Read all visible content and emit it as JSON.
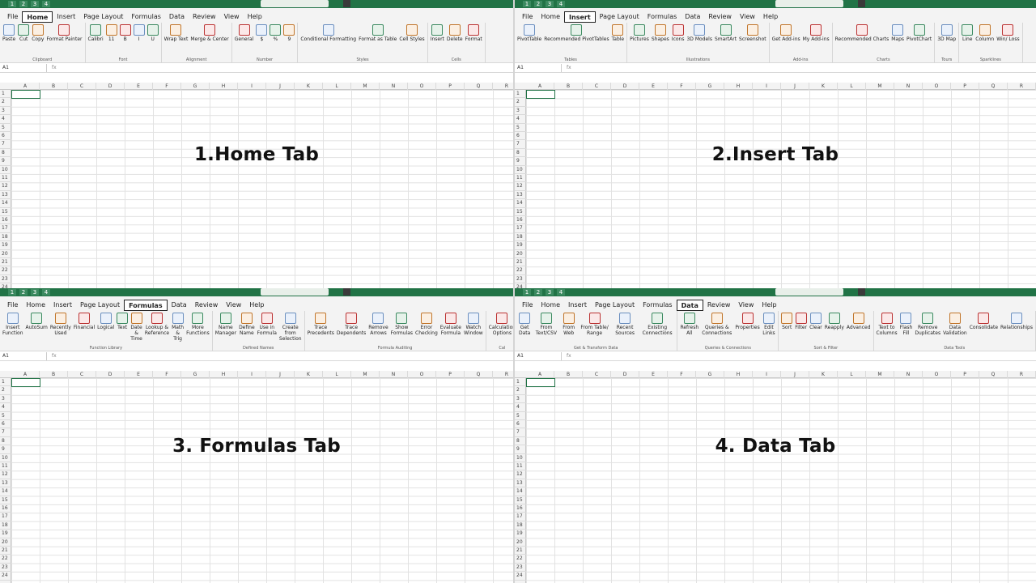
{
  "panels": [
    {
      "caption": "1.Home Tab",
      "selected_tab": "Home",
      "groups": [
        {
          "name": "Clipboard",
          "items": [
            "Paste",
            "Cut",
            "Copy",
            "Format Painter"
          ]
        },
        {
          "name": "Font",
          "items": [
            "Calibri",
            "11",
            "B",
            "I",
            "U"
          ]
        },
        {
          "name": "Alignment",
          "items": [
            "Wrap Text",
            "Merge & Center"
          ]
        },
        {
          "name": "Number",
          "items": [
            "General",
            "$",
            "%",
            "9"
          ]
        },
        {
          "name": "Styles",
          "items": [
            "Conditional Formatting",
            "Format as Table",
            "Cell Styles"
          ]
        },
        {
          "name": "Cells",
          "items": [
            "Insert",
            "Delete",
            "Format"
          ]
        }
      ]
    },
    {
      "caption": "2.Insert Tab",
      "selected_tab": "Insert",
      "groups": [
        {
          "name": "Tables",
          "items": [
            "PivotTable",
            "Recommended PivotTables",
            "Table"
          ]
        },
        {
          "name": "Illustrations",
          "items": [
            "Pictures",
            "Shapes",
            "Icons",
            "3D Models",
            "SmartArt",
            "Screenshot"
          ]
        },
        {
          "name": "Add-ins",
          "items": [
            "Get Add-ins",
            "My Add-ins"
          ]
        },
        {
          "name": "Charts",
          "items": [
            "Recommended Charts",
            "Maps",
            "PivotChart"
          ]
        },
        {
          "name": "Tours",
          "items": [
            "3D Map"
          ]
        },
        {
          "name": "Sparklines",
          "items": [
            "Line",
            "Column",
            "Win/ Loss"
          ]
        }
      ]
    },
    {
      "caption": "3. Formulas Tab",
      "selected_tab": "Formulas",
      "groups": [
        {
          "name": "Function Library",
          "items": [
            "Insert Function",
            "AutoSum",
            "Recently Used",
            "Financial",
            "Logical",
            "Text",
            "Date & Time",
            "Lookup & Reference",
            "Math & Trig",
            "More Functions"
          ]
        },
        {
          "name": "Defined Names",
          "items": [
            "Name Manager",
            "Define Name",
            "Use in Formula",
            "Create from Selection"
          ]
        },
        {
          "name": "Formula Auditing",
          "items": [
            "Trace Precedents",
            "Trace Dependents",
            "Remove Arrows",
            "Show Formulas",
            "Error Checking",
            "Evaluate Formula",
            "Watch Window"
          ]
        },
        {
          "name": "Cal",
          "items": [
            "Calculation Options"
          ]
        }
      ]
    },
    {
      "caption": "4. Data Tab",
      "selected_tab": "Data",
      "groups": [
        {
          "name": "Get & Transform Data",
          "items": [
            "Get Data",
            "From Text/CSV",
            "From Web",
            "From Table/ Range",
            "Recent Sources",
            "Existing Connections"
          ]
        },
        {
          "name": "Queries & Connections",
          "items": [
            "Refresh All",
            "Queries & Connections",
            "Properties",
            "Edit Links"
          ]
        },
        {
          "name": "Sort & Filter",
          "items": [
            "Sort",
            "Filter",
            "Clear",
            "Reapply",
            "Advanced"
          ]
        },
        {
          "name": "Data Tools",
          "items": [
            "Text to Columns",
            "Flash Fill",
            "Remove Duplicates",
            "Data Validation",
            "Consolidate",
            "Relationships"
          ]
        }
      ]
    }
  ],
  "tabs": [
    "File",
    "Home",
    "Insert",
    "Page Layout",
    "Formulas",
    "Data",
    "Review",
    "View",
    "Help"
  ],
  "name_box": "A1",
  "fx_label": "fx",
  "columns": [
    "A",
    "B",
    "C",
    "D",
    "E",
    "F",
    "G",
    "H",
    "I",
    "J",
    "K",
    "L",
    "M",
    "N",
    "O",
    "P",
    "Q",
    "R"
  ],
  "rows": [
    "1",
    "2",
    "3",
    "4",
    "5",
    "6",
    "7",
    "8",
    "9",
    "10",
    "11",
    "12",
    "13",
    "14",
    "15",
    "16",
    "17",
    "18",
    "19",
    "20",
    "21",
    "22",
    "23",
    "24"
  ],
  "quick_access_keytips": [
    "1",
    "2",
    "3",
    "4"
  ],
  "colors": {
    "excel_green": "#217346",
    "ribbon_bg": "#f3f3f3"
  }
}
